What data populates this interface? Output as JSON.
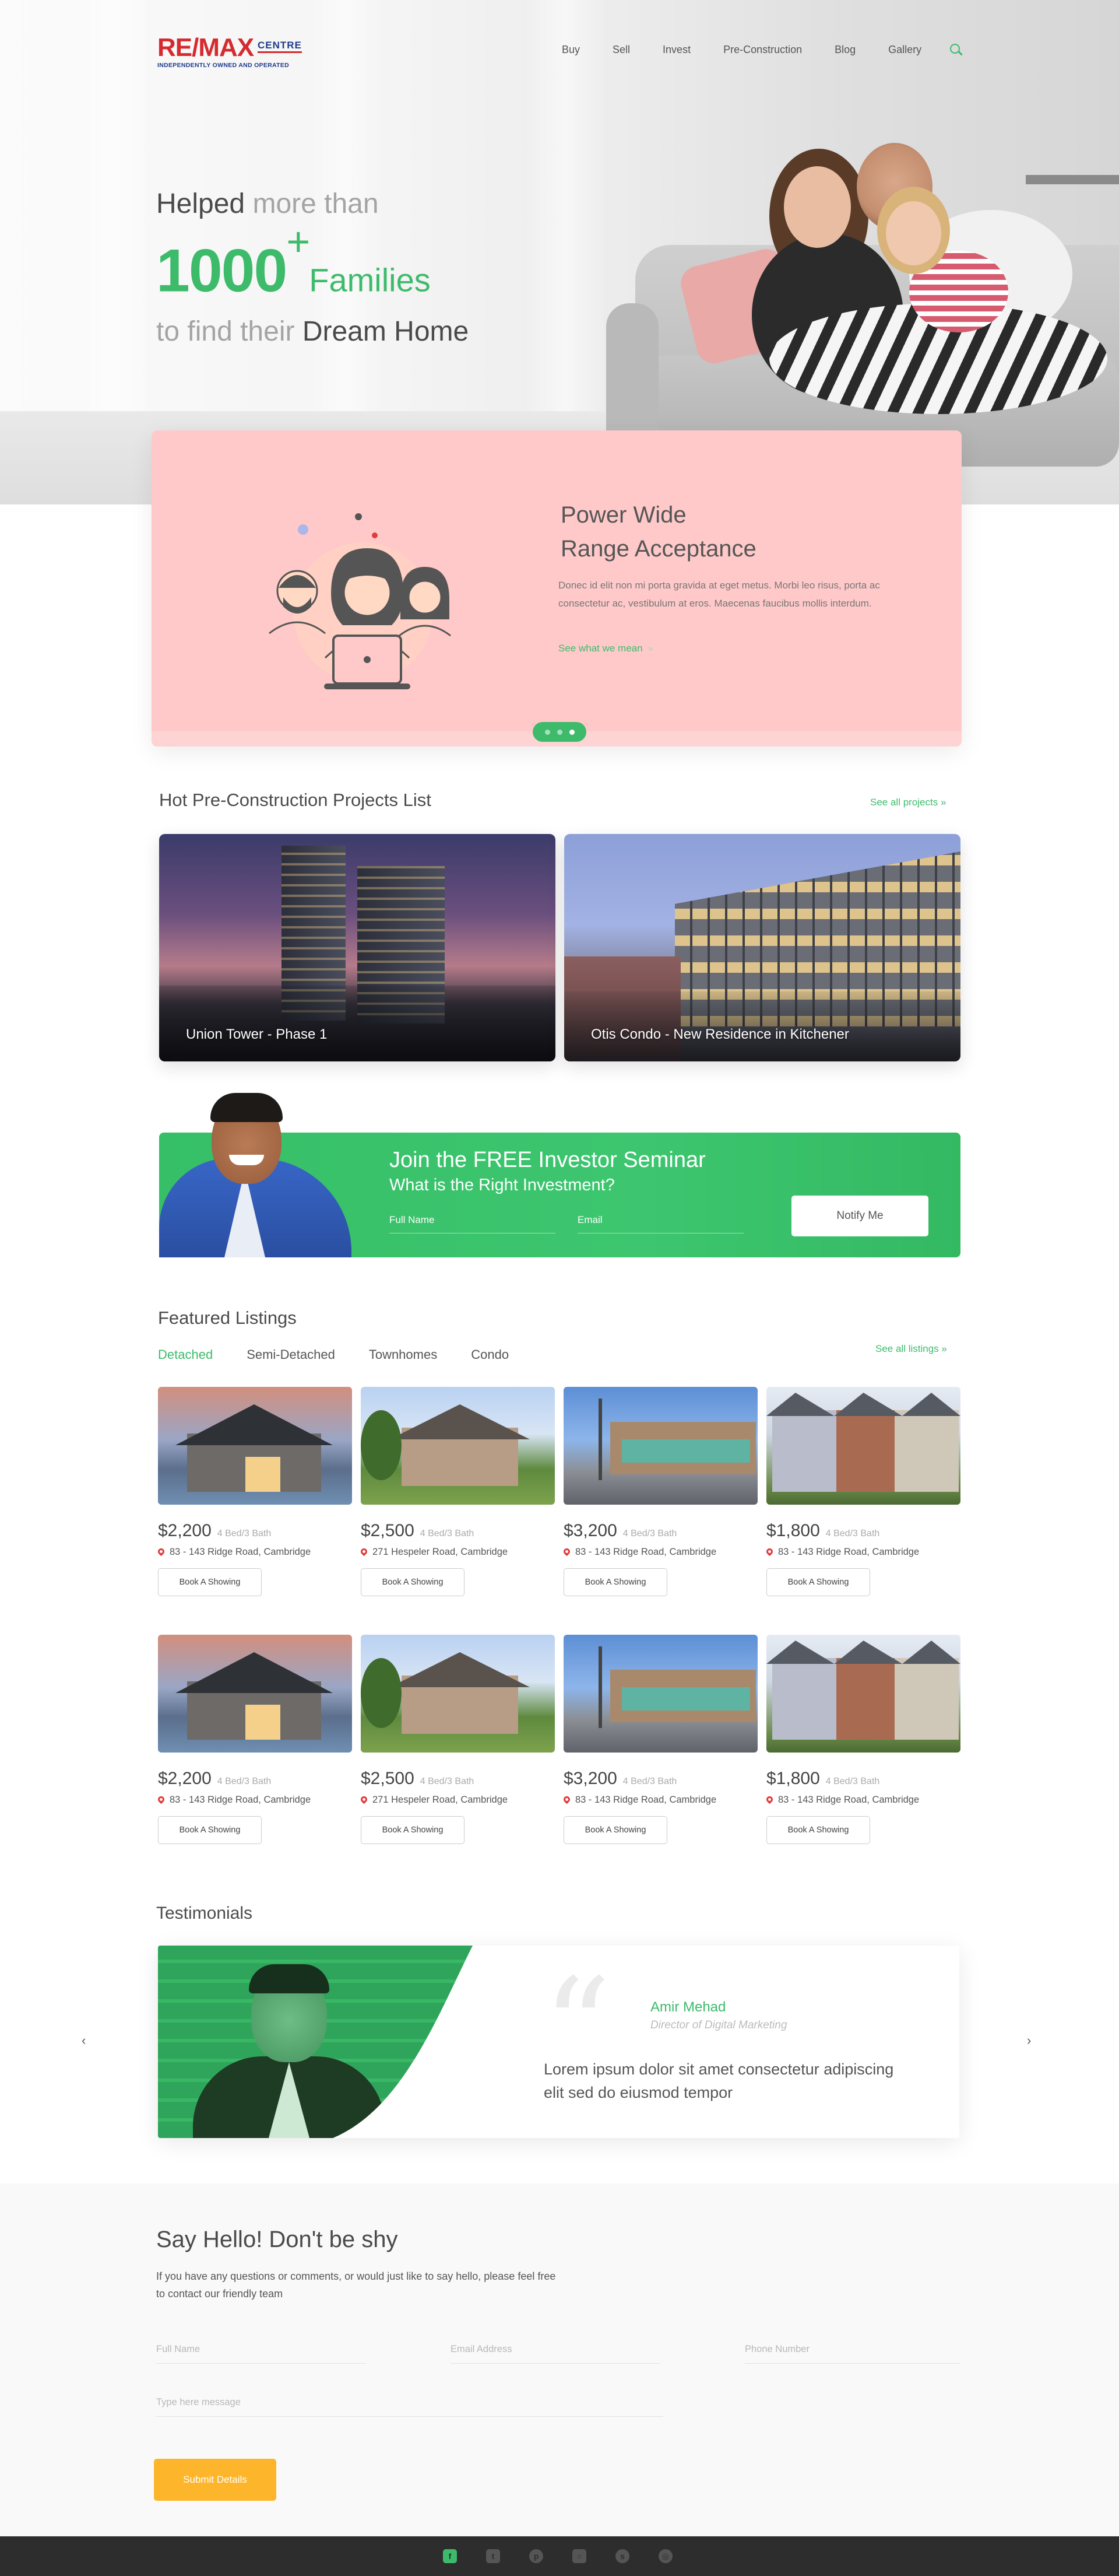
{
  "header": {
    "logo_text": "RE/MAX",
    "logo_centre": "CENTRE",
    "logo_tagline": "INDEPENDENTLY OWNED AND OPERATED",
    "nav": [
      "Buy",
      "Sell",
      "Invest",
      "Pre-Construction",
      "Blog",
      "Gallery"
    ],
    "search_icon": "search-icon"
  },
  "hero": {
    "helped": "Helped",
    "more_than": "more than",
    "count": "1000",
    "plus": "+",
    "families": "Families",
    "to_find": "to find their",
    "dream_home": "Dream Home"
  },
  "slider": {
    "title_line1": "Power Wide",
    "title_line2": "Range Acceptance",
    "description": "Donec id elit non mi porta gravida at eget metus. Morbi leo risus, porta ac consectetur ac, vestibulum at eros. Maecenas faucibus mollis interdum.",
    "link": "See what we mean",
    "link_arrow": "»",
    "active_slide": 3,
    "slide_count": 3
  },
  "projects": {
    "title": "Hot Pre-Construction Projects List",
    "see_all": "See all projects",
    "see_all_arrow": "»",
    "items": [
      {
        "name": "Union Tower - Phase 1"
      },
      {
        "name": "Otis Condo - New Residence in Kitchener"
      }
    ]
  },
  "seminar": {
    "title": "Join the FREE Investor Seminar",
    "subtitle": "What is the Right Investment?",
    "name_placeholder": "Full Name",
    "email_placeholder": "Email",
    "button": "Notify Me"
  },
  "featured": {
    "title": "Featured Listings",
    "see_all": "See all listings",
    "see_all_arrow": "»",
    "tabs": [
      "Detached",
      "Semi-Detached",
      "Townhomes",
      "Condo"
    ],
    "active_tab": "Detached",
    "book_label": "Book A Showing",
    "listings": [
      {
        "price": "$2,200",
        "beds": "4 Bed/3 Bath",
        "address": "83 - 143 Ridge Road, Cambridge"
      },
      {
        "price": "$2,500",
        "beds": "4 Bed/3 Bath",
        "address": "271 Hespeler Road, Cambridge"
      },
      {
        "price": "$3,200",
        "beds": "4 Bed/3 Bath",
        "address": "83 - 143 Ridge Road, Cambridge"
      },
      {
        "price": "$1,800",
        "beds": "4 Bed/3 Bath",
        "address": "83 - 143 Ridge Road, Cambridge"
      },
      {
        "price": "$2,200",
        "beds": "4 Bed/3 Bath",
        "address": "83 - 143 Ridge Road, Cambridge"
      },
      {
        "price": "$2,500",
        "beds": "4 Bed/3 Bath",
        "address": "271 Hespeler Road, Cambridge"
      },
      {
        "price": "$3,200",
        "beds": "4 Bed/3 Bath",
        "address": "83 - 143 Ridge Road, Cambridge"
      },
      {
        "price": "$1,800",
        "beds": "4 Bed/3 Bath",
        "address": "83 - 143 Ridge Road, Cambridge"
      }
    ]
  },
  "testimonials": {
    "title": "Testimonials",
    "name": "Amir Mehad",
    "role": "Director of Digital Marketing",
    "quote": "Lorem ipsum dolor sit amet consectetur adipiscing elit sed do eiusmod tempor",
    "prev": "‹",
    "next": "›"
  },
  "contact": {
    "title": "Say Hello! Don't be shy",
    "intro": "If you have any questions or comments, or would just like to say hello, please feel free to contact our friendly team",
    "full_name": "Full Name",
    "email": "Email Address",
    "phone": "Phone Number",
    "message": "Type here message",
    "submit": "Submit Details"
  },
  "footer": {
    "social": [
      "facebook-icon",
      "twitter-icon",
      "pinterest-icon",
      "instagram-icon",
      "skype-icon",
      "dribbble-icon"
    ]
  },
  "colors": {
    "brand_green": "#3dbb6b",
    "remax_red": "#d52b2f",
    "remax_blue": "#1e3a8a",
    "slider_pink": "#ffc9c9",
    "submit_orange": "#fdb62c",
    "footer_dark": "#2d2d2d"
  }
}
